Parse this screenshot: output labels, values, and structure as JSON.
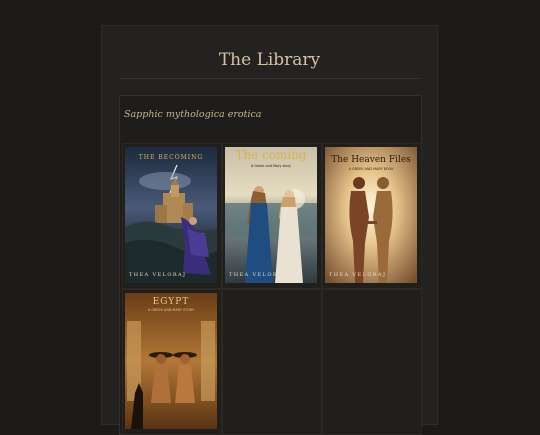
{
  "page": {
    "title": "The Library"
  },
  "shelf": {
    "caption": "Sapphic mythologica erotica",
    "books": [
      {
        "title": "THE BECOMING",
        "subtitle": "",
        "author": "THEA VELORAJ",
        "cover_icon": "sorceress-castle-cover-art"
      },
      {
        "title": "The coming",
        "subtitle": "A Greek and Mary story",
        "author": "THEA VELORAJ",
        "cover_icon": "two-women-seashore-cover-art"
      },
      {
        "title": "The Heaven Files",
        "subtitle": "A GREEK AND MARY BOOK",
        "author": "THEA VELORAJ",
        "cover_icon": "two-women-light-cover-art"
      },
      {
        "title": "EGYPT",
        "subtitle": "A GREEK AND MARY STORY",
        "author": "",
        "cover_icon": "egyptian-goddesses-cover-art"
      }
    ]
  },
  "colors": {
    "background": "#1c1b19",
    "panel": "#242220",
    "title": "#d3c2a3",
    "caption": "#c9b48b",
    "gold": "#d9b24a"
  }
}
